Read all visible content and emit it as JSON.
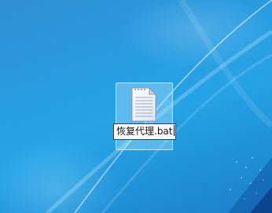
{
  "desktop": {
    "background_color": "#259fe3",
    "file": {
      "icon": "batch-file-icon",
      "name": "恢复代理.bat",
      "state": "renaming"
    }
  }
}
